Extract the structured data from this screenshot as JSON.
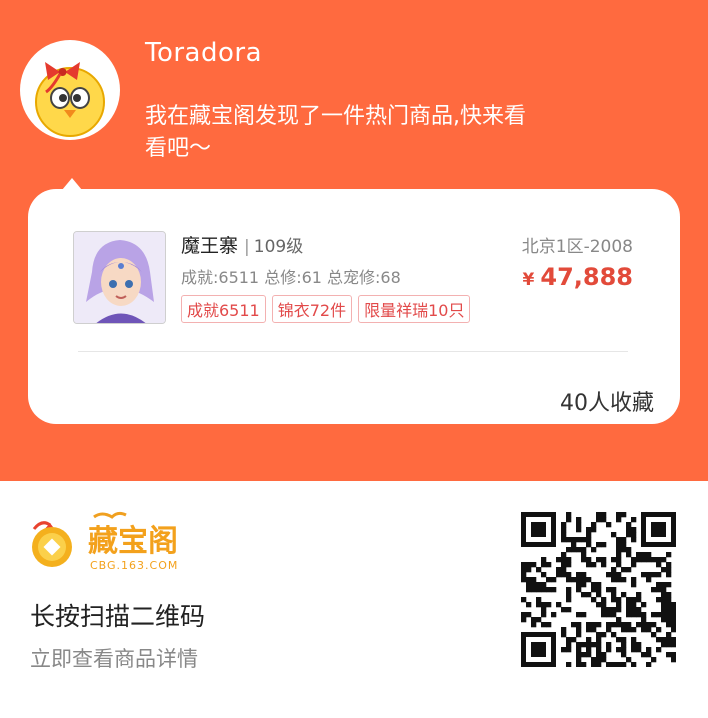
{
  "colors": {
    "brand": "#ff6a3f",
    "price": "#e24a3a",
    "tag": "#e24a4a"
  },
  "share": {
    "username": "Toradora",
    "message": "我在藏宝阁发现了一件热门商品,快来看看吧～"
  },
  "item": {
    "name": "魔王寨",
    "sep": "|",
    "level": "109级",
    "stats": "成就:6511 总修:61 总宠修:68",
    "tags": [
      "成就6511",
      "锦衣72件",
      "限量祥瑞10只"
    ],
    "server": "北京1区-2008",
    "currency": "¥",
    "price": "47,888",
    "collect_count": "40人收藏"
  },
  "footer": {
    "logo_text": "藏宝阁",
    "logo_url": "CBG.163.COM",
    "scan_title": "长按扫描二维码",
    "scan_subtitle": "立即查看商品详情"
  },
  "icons": {
    "avatar": "chick-avatar-icon",
    "logo": "cbg-logo-icon",
    "qr": "qr-code-icon"
  }
}
